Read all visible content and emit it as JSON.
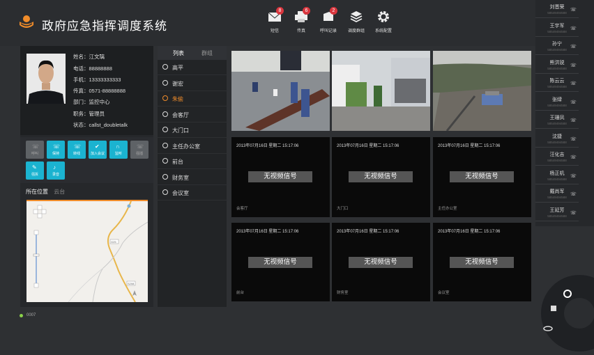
{
  "header": {
    "title": "政府应急指挥调度系统"
  },
  "toolbar": [
    {
      "label": "短信",
      "badge": "8"
    },
    {
      "label": "传真",
      "badge": "6"
    },
    {
      "label": "呼叫记录",
      "badge": "2"
    },
    {
      "label": "调度群组",
      "badge": ""
    },
    {
      "label": "系统配置",
      "badge": ""
    }
  ],
  "profile": {
    "name": "姓名：江文璃",
    "phone": "电话：88888888",
    "mobile": "手机：13333333333",
    "fax": "传真：0571-88888888",
    "dept": "部门：监控中心",
    "role": "职务：管理员",
    "state": "状态：callst_doubletalk"
  },
  "actions": [
    {
      "label": "呼叫",
      "on": false
    },
    {
      "label": "保持",
      "on": true
    },
    {
      "label": "转线",
      "on": true
    },
    {
      "label": "加入会议",
      "on": true
    },
    {
      "label": "监听",
      "on": true
    },
    {
      "label": "强插",
      "on": false
    },
    {
      "label": "强拆",
      "on": true
    },
    {
      "label": "录音",
      "on": true
    }
  ],
  "map": {
    "tab_location": "所在位置",
    "tab_ptz": "云台",
    "road1": "G25",
    "road2": "S208"
  },
  "list_tabs": {
    "list": "列表",
    "group": "群组"
  },
  "camera_list": [
    "高平",
    "谢宏",
    "朱偷",
    "会客厅",
    "大门口",
    "主任办公室",
    "前台",
    "财务室",
    "会议室"
  ],
  "selected_index": 2,
  "video": {
    "timestamp": "2013年07月16日  星期二   15:17:06",
    "no_signal": "无视频信号",
    "labels": [
      "会客厅",
      "大门口",
      "主任办公室",
      "前台",
      "财务室",
      "会议室"
    ]
  },
  "contacts": [
    {
      "name": "刘晋荣",
      "phone": "58549494588"
    },
    {
      "name": "王宇军",
      "phone": "58549494588"
    },
    {
      "name": "孙宁",
      "phone": "58549494588"
    },
    {
      "name": "熊洪锐",
      "phone": "58549494588"
    },
    {
      "name": "陈云云",
      "phone": "58549494588"
    },
    {
      "name": "张绿",
      "phone": "58549494588"
    },
    {
      "name": "王珊凤",
      "phone": "58549494588"
    },
    {
      "name": "沈捷",
      "phone": "58549494588"
    },
    {
      "name": "汪化吉",
      "phone": "58549494588"
    },
    {
      "name": "杨正机",
      "phone": "58549494588"
    },
    {
      "name": "戴尚军",
      "phone": "58549494588"
    },
    {
      "name": "王延芳",
      "phone": "58549494588"
    }
  ],
  "status": {
    "code": "0007"
  },
  "colors": {
    "accent": "#1bb3d0",
    "orange": "#f08c2a",
    "badge": "#d9363e",
    "online": "#8ad14a"
  }
}
